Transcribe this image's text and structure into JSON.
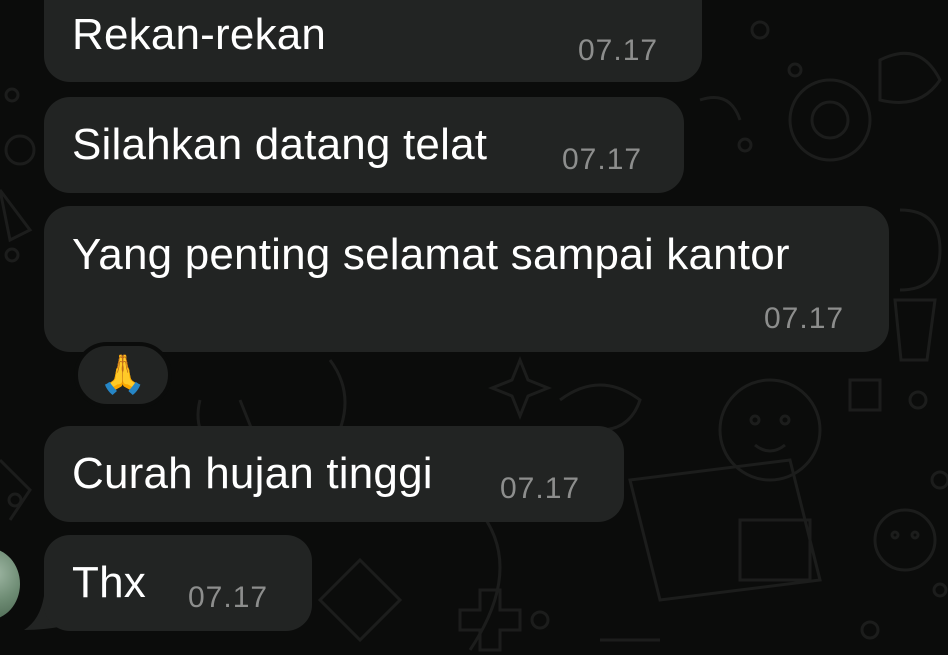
{
  "chat": {
    "messages": [
      {
        "text": "Rekan-rekan",
        "time": "07.17"
      },
      {
        "text": "Silahkan datang telat",
        "time": "07.17"
      },
      {
        "text": "Yang penting selamat sampai kantor",
        "time": "07.17"
      },
      {
        "text": "Curah hujan tinggi",
        "time": "07.17"
      },
      {
        "text": "Thx",
        "time": "07.17"
      }
    ],
    "reaction": {
      "emoji": "🙏",
      "icon": "folded-hands-icon"
    }
  },
  "colors": {
    "background": "#0b0c0b",
    "bubble": "#222423",
    "text": "#ffffff",
    "timestamp": "#8d8e8d"
  }
}
